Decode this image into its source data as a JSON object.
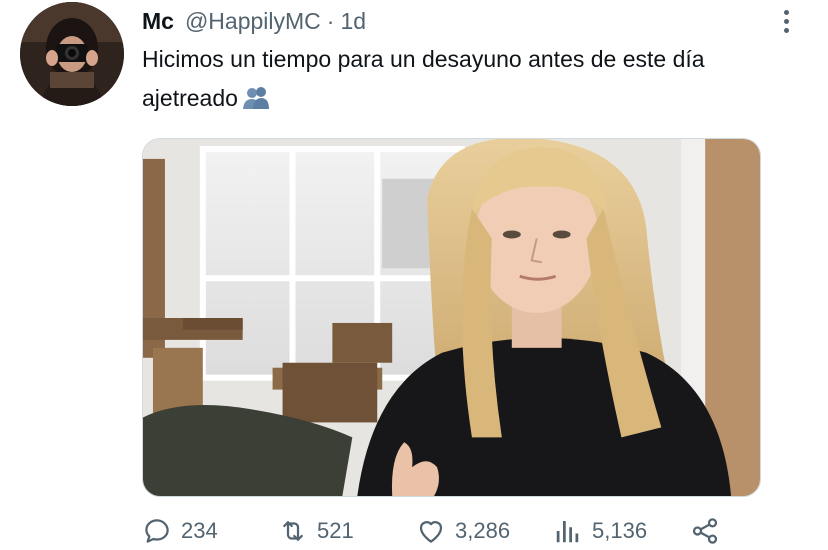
{
  "tweet": {
    "author_name": "Mc",
    "handle": "@HappilyMC",
    "separator": "·",
    "time": "1d",
    "text": "Hicimos un tiempo para un desayuno antes de este día ajetreado",
    "emoji_icon": "people-silhouette-emoji"
  },
  "actions": {
    "replies": "234",
    "retweets": "521",
    "likes": "3,286",
    "views": "5,136"
  },
  "colors": {
    "text": "#0f1419",
    "secondary": "#536471",
    "border": "#cfd9de"
  }
}
